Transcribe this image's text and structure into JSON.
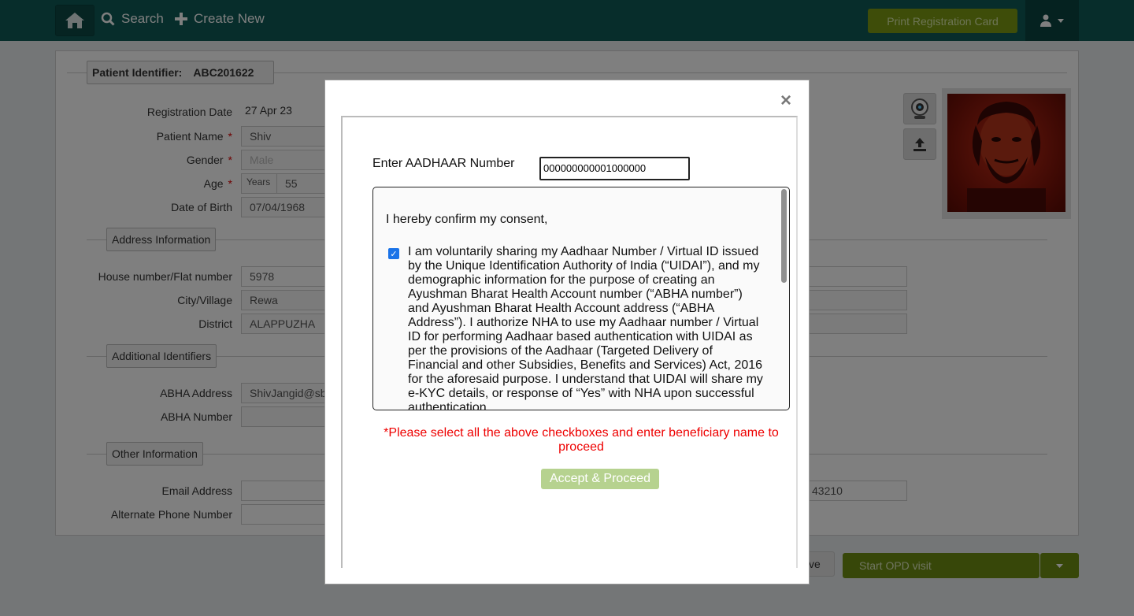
{
  "navbar": {
    "search_label": "Search",
    "create_new_label": "Create New",
    "print_label": "Print Registration Card"
  },
  "patient": {
    "identifier_label": "Patient Identifier:",
    "identifier_value": "ABC201622",
    "registration_date_label": "Registration Date",
    "registration_date_value": "27 Apr 23",
    "name_label": "Patient Name",
    "name_value": "Shiv",
    "gender_label": "Gender",
    "gender_value": "Male",
    "age_label": "Age",
    "age_unit": "Years",
    "age_value": "55",
    "dob_label": "Date of Birth",
    "dob_value": "07/04/1968",
    "required_mark": "*"
  },
  "address": {
    "section_title": "Address Information",
    "house_label": "House number/Flat number",
    "house_value": "5978",
    "city_label": "City/Village",
    "city_value": "Rewa",
    "district_label": "District",
    "district_value": "ALAPPUZHA"
  },
  "identifiers": {
    "section_title": "Additional Identifiers",
    "abha_address_label": "ABHA Address",
    "abha_address_value": "ShivJangid@sb",
    "abha_number_label": "ABHA Number",
    "abha_number_value": ""
  },
  "other": {
    "section_title": "Other Information",
    "email_label": "Email Address",
    "email_value": "",
    "alt_phone_label": "Alternate Phone Number",
    "alt_phone_value": "",
    "phone_partial": "43210"
  },
  "footer": {
    "save_partial": "ve",
    "start_opd_label": "Start OPD visit"
  },
  "modal": {
    "close_symbol": "×",
    "aadhaar_label": "Enter AADHAAR Number",
    "aadhaar_value": "000000000001000000",
    "consent_title": "I hereby confirm my consent,",
    "consent_checked": true,
    "consent_text": "I am voluntarily sharing my Aadhaar Number / Virtual ID issued by the Unique Identification Authority of India (“UIDAI”), and my demographic information for the purpose of creating an Ayushman Bharat Health Account number (“ABHA number”) and Ayushman Bharat Health Account address (“ABHA Address”). I authorize NHA to use my Aadhaar number / Virtual ID for performing Aadhaar based authentication with UIDAI as per the provisions of the Aadhaar (Targeted Delivery of Financial and other Subsidies, Benefits and Services) Act, 2016 for the aforesaid purpose. I understand that UIDAI will share my e-KYC details, or response of “Yes” with NHA upon successful authentication.",
    "warning_text": "*Please select all the above checkboxes and enter beneficiary name to proceed",
    "accept_label": "Accept & Proceed"
  },
  "colors": {
    "navbar": "#0f5a56",
    "print_button": "#7d9a12",
    "start_opd": "#6f8e12",
    "accept_button": "#b6d28f",
    "warning": "#e00000"
  },
  "icons": {
    "home": "home-icon",
    "search": "search-icon",
    "create": "plus-icon",
    "user": "doctor-icon",
    "webcam": "webcam-icon",
    "upload": "upload-icon",
    "caret": "caret-down-icon"
  }
}
